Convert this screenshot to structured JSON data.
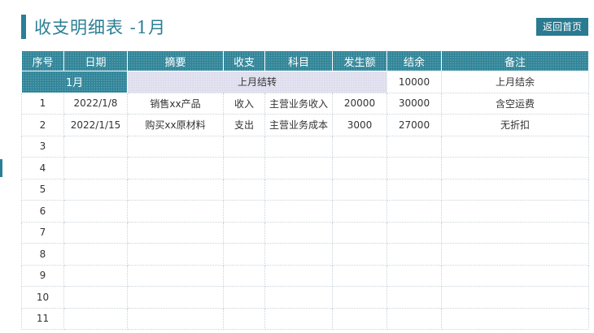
{
  "header": {
    "title": "收支明细表 -1月",
    "home_button": "返回首页"
  },
  "table": {
    "columns": [
      "序号",
      "日期",
      "摘要",
      "收支",
      "科目",
      "发生额",
      "结余",
      "备注"
    ],
    "carry_row": {
      "month": "1月",
      "label": "上月结转",
      "balance": "10000",
      "note": "上月结余"
    },
    "rows": [
      {
        "no": "1",
        "date": "2022/1/8",
        "summary": "销售xx产品",
        "type": "收入",
        "subject": "主营业务收入",
        "amount": "20000",
        "balance": "30000",
        "note": "含空运费"
      },
      {
        "no": "2",
        "date": "2022/1/15",
        "summary": "购买xx原材料",
        "type": "支出",
        "subject": "主营业务成本",
        "amount": "3000",
        "balance": "27000",
        "note": "无折扣"
      },
      {
        "no": "3",
        "date": "",
        "summary": "",
        "type": "",
        "subject": "",
        "amount": "",
        "balance": "",
        "note": ""
      },
      {
        "no": "4",
        "date": "",
        "summary": "",
        "type": "",
        "subject": "",
        "amount": "",
        "balance": "",
        "note": ""
      },
      {
        "no": "5",
        "date": "",
        "summary": "",
        "type": "",
        "subject": "",
        "amount": "",
        "balance": "",
        "note": ""
      },
      {
        "no": "6",
        "date": "",
        "summary": "",
        "type": "",
        "subject": "",
        "amount": "",
        "balance": "",
        "note": ""
      },
      {
        "no": "7",
        "date": "",
        "summary": "",
        "type": "",
        "subject": "",
        "amount": "",
        "balance": "",
        "note": ""
      },
      {
        "no": "8",
        "date": "",
        "summary": "",
        "type": "",
        "subject": "",
        "amount": "",
        "balance": "",
        "note": ""
      },
      {
        "no": "9",
        "date": "",
        "summary": "",
        "type": "",
        "subject": "",
        "amount": "",
        "balance": "",
        "note": ""
      },
      {
        "no": "10",
        "date": "",
        "summary": "",
        "type": "",
        "subject": "",
        "amount": "",
        "balance": "",
        "note": ""
      },
      {
        "no": "11",
        "date": "",
        "summary": "",
        "type": "",
        "subject": "",
        "amount": "",
        "balance": "",
        "note": ""
      }
    ]
  },
  "colors": {
    "accent": "#2b7f95",
    "carry_fill": "#e3e3f1",
    "grid": "#c9d3da"
  }
}
